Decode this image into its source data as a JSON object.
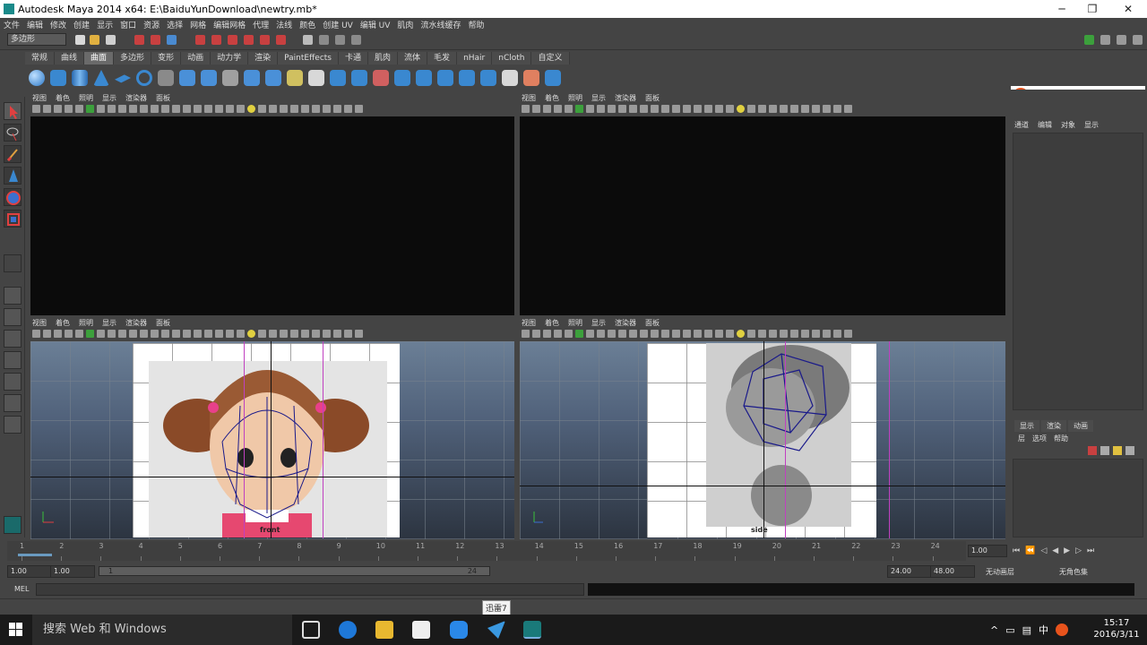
{
  "window": {
    "title": "Autodesk Maya 2014 x64: E:\\BaiduYunDownload\\newtry.mb*"
  },
  "menubar": [
    "文件",
    "编辑",
    "修改",
    "创建",
    "显示",
    "窗口",
    "资源",
    "选择",
    "网格",
    "编辑网格",
    "代理",
    "法线",
    "颜色",
    "创建 UV",
    "编辑 UV",
    "肌肉",
    "流水线缓存",
    "帮助"
  ],
  "statusline": {
    "mode": "多边形"
  },
  "shelf": {
    "tabs": [
      "常规",
      "曲线",
      "曲面",
      "多边形",
      "变形",
      "动画",
      "动力学",
      "渲染",
      "PaintEffects",
      "卡通",
      "肌肉",
      "流体",
      "毛发",
      "nHair",
      "nCloth",
      "自定义"
    ],
    "active_tab": "曲面"
  },
  "viewport_menu": [
    "视图",
    "着色",
    "照明",
    "显示",
    "渲染器",
    "面板"
  ],
  "viewports": {
    "front": {
      "label": "front"
    },
    "side": {
      "label": "side"
    }
  },
  "channelbox": {
    "tabs": [
      "通道",
      "编辑",
      "对象",
      "显示"
    ]
  },
  "layers": {
    "tabs": [
      "显示",
      "渲染",
      "动画"
    ],
    "menu": [
      "层",
      "选项",
      "帮助"
    ]
  },
  "timeslider": {
    "ticks": [
      "1",
      "2",
      "3",
      "4",
      "5",
      "6",
      "7",
      "8",
      "9",
      "10",
      "11",
      "12",
      "13",
      "14",
      "15",
      "16",
      "17",
      "18",
      "19",
      "20",
      "21",
      "22",
      "23",
      "24"
    ],
    "current_time": "1.00"
  },
  "range": {
    "start": "1.00",
    "playback_start": "1.00",
    "range_start_label": "1",
    "range_end_label": "24",
    "playback_end": "24.00",
    "end": "48.00",
    "anim_layer": "无动画层",
    "char_set": "无角色集"
  },
  "mel": {
    "label": "MEL"
  },
  "tooltip": "迅雷7",
  "taskbar": {
    "search_placeholder": "搜索 Web 和 Windows",
    "clock_time": "15:17",
    "clock_date": "2016/3/11",
    "ime": "中"
  }
}
